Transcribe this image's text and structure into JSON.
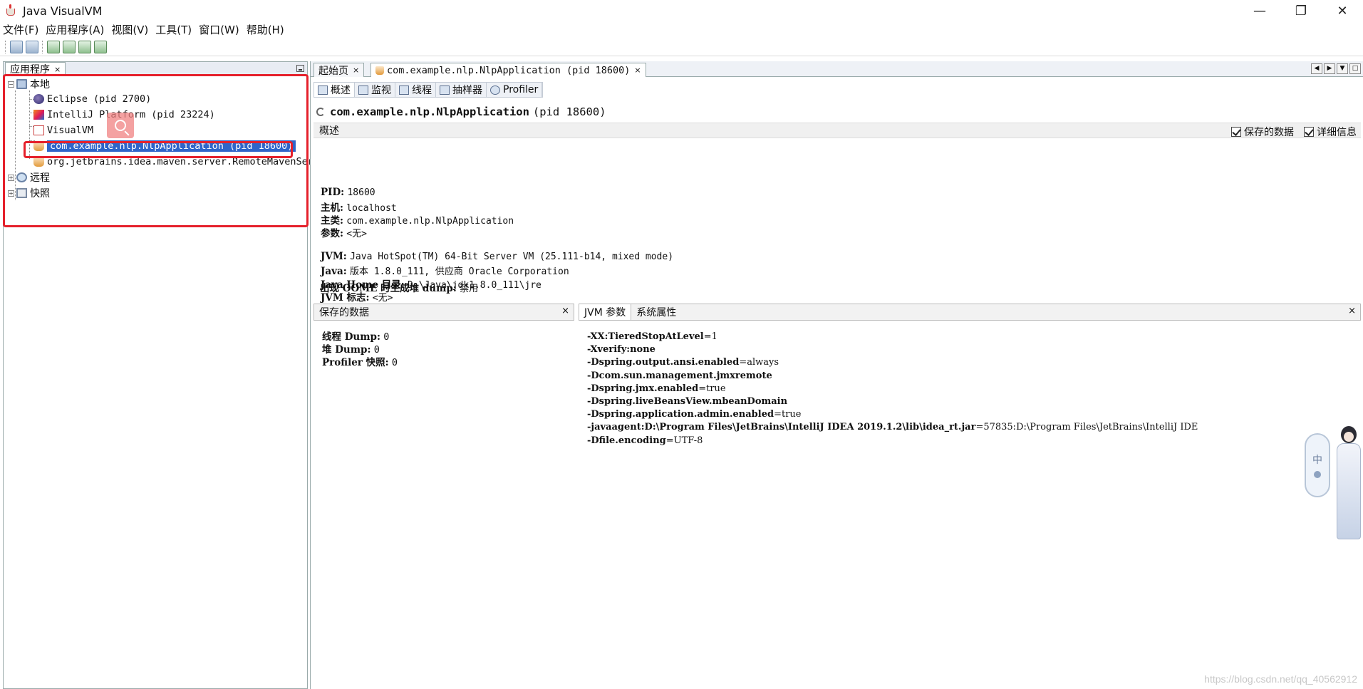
{
  "window": {
    "title": "Java VisualVM",
    "controls": {
      "minimize": "—",
      "restore": "❐",
      "close": "✕"
    }
  },
  "menu": [
    "文件(F)",
    "应用程序(A)",
    "视图(V)",
    "工具(T)",
    "窗口(W)",
    "帮助(H)"
  ],
  "left_panel": {
    "tab_label": "应用程序",
    "tab_close": "×",
    "tree": {
      "local": "本地",
      "apps": [
        {
          "label": "Eclipse (pid 2700)",
          "icon": "eclipse-icon"
        },
        {
          "label": "IntelliJ Platform (pid 23224)",
          "icon": "intellij-icon"
        },
        {
          "label": "VisualVM",
          "icon": "visualvm-icon"
        },
        {
          "label": "com.example.nlp.NlpApplication (pid 18600)",
          "icon": "java-icon",
          "selected": true
        },
        {
          "label": "org.jetbrains.idea.maven.server.RemoteMavenSer",
          "icon": "java-icon"
        }
      ],
      "remote": "远程",
      "snapshots": "快照"
    }
  },
  "doc_tabs": [
    {
      "label": "起始页",
      "close": "×"
    },
    {
      "label": "com.example.nlp.NlpApplication (pid 18600)",
      "close": "×"
    }
  ],
  "sub_tabs": [
    "概述",
    "监视",
    "线程",
    "抽样器",
    "Profiler"
  ],
  "heading": {
    "app": "com.example.nlp.NlpApplication",
    "pid": "(pid 18600)"
  },
  "overview": {
    "section_title": "概述",
    "check_saved": "保存的数据",
    "check_details": "详细信息",
    "pid_label": "PID:",
    "pid": "18600",
    "host_label": "主机:",
    "host": "localhost",
    "main_class_label": "主类:",
    "main_class": "com.example.nlp.NlpApplication",
    "args_label": "参数:",
    "args": "<无>",
    "jvm_label": "JVM:",
    "jvm": "Java HotSpot(TM) 64-Bit Server VM (25.111-b14, mixed mode)",
    "java_label": "Java:",
    "java": "版本 1.8.0_111, 供应商 Oracle Corporation",
    "java_home_label": "Java Home 目录:",
    "java_home": "D:\\Java\\jdk1.8.0_111\\jre",
    "jvm_flags_label": "JVM 标志:",
    "jvm_flags": "<无>",
    "oome_label": "出现 OOME 时生成堆 dump:",
    "oome": "禁用"
  },
  "saved_panel": {
    "title": "保存的数据",
    "close": "×",
    "thread_dump_label": "线程 Dump:",
    "thread_dump": "0",
    "heap_dump_label": "堆 Dump:",
    "heap_dump": "0",
    "profiler_label": "Profiler 快照:",
    "profiler": "0"
  },
  "jvm_panel": {
    "tab_jvm": "JVM 参数",
    "tab_sys": "系统属性",
    "close": "×",
    "args": [
      {
        "key": "-XX:TieredStopAtLevel",
        "value": "=1"
      },
      {
        "key": "-Xverify:none",
        "value": ""
      },
      {
        "key": "-Dspring.output.ansi.enabled",
        "value": "=always"
      },
      {
        "key": "-Dcom.sun.management.jmxremote",
        "value": ""
      },
      {
        "key": "-Dspring.jmx.enabled",
        "value": "=true"
      },
      {
        "key": "-Dspring.liveBeansView.mbeanDomain",
        "value": ""
      },
      {
        "key": "-Dspring.application.admin.enabled",
        "value": "=true"
      },
      {
        "key": "-javaagent:D:\\Program  Files\\JetBrains\\IntelliJ  IDEA  2019.1.2\\lib\\idea_rt.jar",
        "value": "=57835:D:\\Program  Files\\JetBrains\\IntelliJ  IDE"
      },
      {
        "key": "-Dfile.encoding",
        "value": "=UTF-8"
      }
    ]
  },
  "ime": {
    "char": "中"
  },
  "watermark": "https://blog.csdn.net/qq_40562912",
  "colors": {
    "selection": "#2f65c9",
    "annotation_red": "#e5202b"
  }
}
